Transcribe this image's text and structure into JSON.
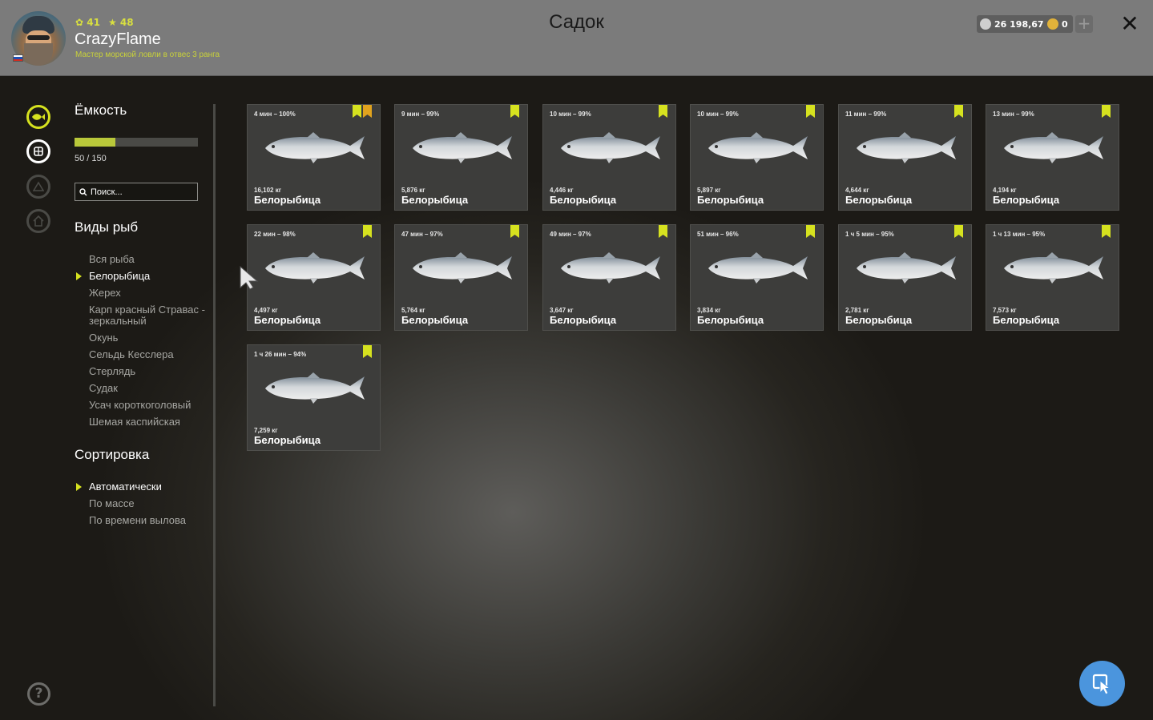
{
  "header": {
    "title": "Садок",
    "player": {
      "name": "CrazyFlame",
      "rank": "Мастер морской ловли в отвес 3 ранга",
      "level": "41",
      "stars": "48"
    },
    "currency": {
      "silver": "26 198,67",
      "gold": "0",
      "add_label": "+"
    },
    "close_label": "✕"
  },
  "sidebar": {
    "capacity_title": "Ёмкость",
    "capacity_text": "50 / 150",
    "capacity_fraction": 0.333,
    "search_placeholder": "Поиск...",
    "species_title": "Виды рыб",
    "species": [
      "Вся рыба",
      "Белорыбица",
      "Жерех",
      "Карп красный Стравас - зеркальный",
      "Окунь",
      "Сельдь Кесслера",
      "Стерлядь",
      "Судак",
      "Усач короткоголовый",
      "Шемая каспийская"
    ],
    "species_selected": 1,
    "sort_title": "Сортировка",
    "sort": [
      "Автоматически",
      "По массе",
      "По времени вылова"
    ],
    "sort_selected": 0,
    "help_label": "?"
  },
  "fish": [
    {
      "time": "4 мин – 100%",
      "weight": "16,102 кг",
      "name": "Белорыбица",
      "star": true
    },
    {
      "time": "9 мин – 99%",
      "weight": "5,876 кг",
      "name": "Белорыбица",
      "star": false
    },
    {
      "time": "10 мин – 99%",
      "weight": "4,446 кг",
      "name": "Белорыбица",
      "star": false
    },
    {
      "time": "10 мин – 99%",
      "weight": "5,897 кг",
      "name": "Белорыбица",
      "star": false
    },
    {
      "time": "11 мин – 99%",
      "weight": "4,644 кг",
      "name": "Белорыбица",
      "star": false
    },
    {
      "time": "13 мин – 99%",
      "weight": "4,194 кг",
      "name": "Белорыбица",
      "star": false
    },
    {
      "time": "22 мин – 98%",
      "weight": "4,497 кг",
      "name": "Белорыбица",
      "star": false
    },
    {
      "time": "47 мин – 97%",
      "weight": "5,764 кг",
      "name": "Белорыбица",
      "star": false
    },
    {
      "time": "49 мин – 97%",
      "weight": "3,647 кг",
      "name": "Белорыбица",
      "star": false
    },
    {
      "time": "51 мин – 96%",
      "weight": "3,834 кг",
      "name": "Белорыбица",
      "star": false
    },
    {
      "time": "1 ч 5 мин – 95%",
      "weight": "2,781 кг",
      "name": "Белорыбица",
      "star": false
    },
    {
      "time": "1 ч 13 мин – 95%",
      "weight": "7,573 кг",
      "name": "Белорыбица",
      "star": false
    },
    {
      "time": "1 ч 26 мин – 94%",
      "weight": "7,259 кг",
      "name": "Белорыбица",
      "star": false
    }
  ],
  "colors": {
    "accent": "#d6e21f",
    "star": "#e1a31e",
    "fab": "#4b95dd"
  }
}
